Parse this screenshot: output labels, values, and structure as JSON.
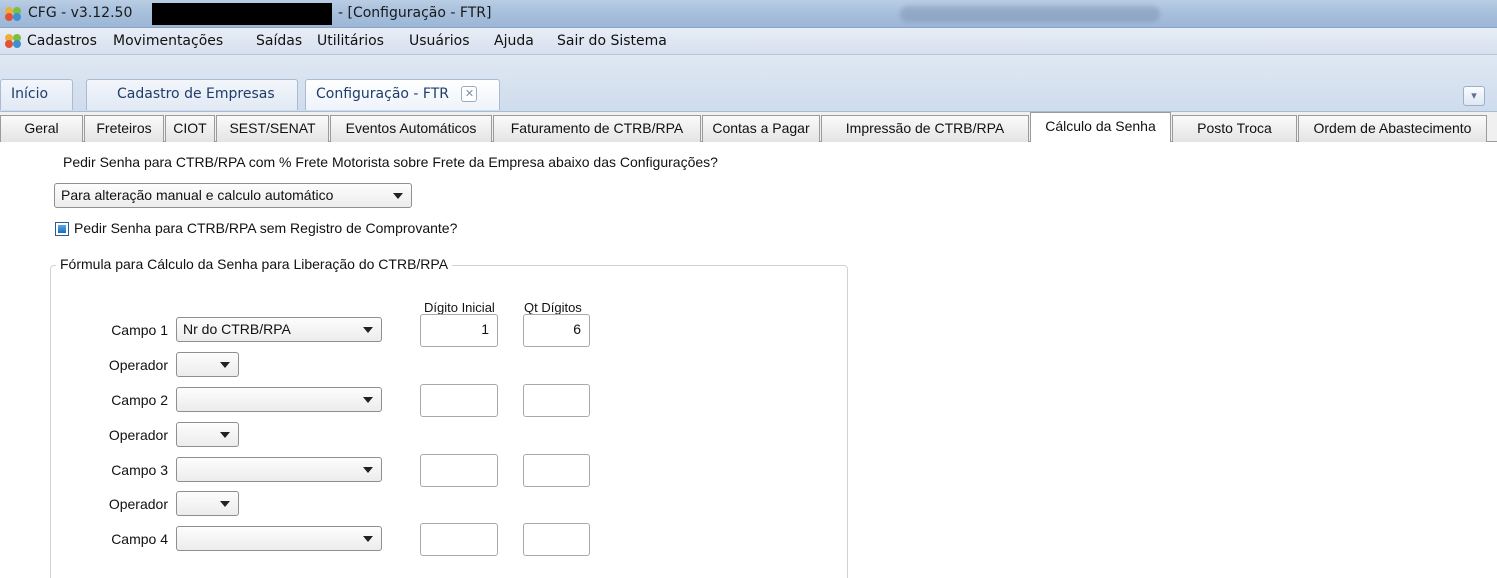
{
  "window": {
    "title_left": "CFG - v3.12.50",
    "title_right": "- [Configuração - FTR]"
  },
  "menu": {
    "items": [
      "Cadastros",
      "Movimentações",
      "Saídas",
      "Utilitários",
      "Usuários",
      "Ajuda",
      "Sair do Sistema"
    ]
  },
  "doc_tabs": {
    "items": [
      "Início",
      "Cadastro de Empresas",
      "Configuração - FTR"
    ],
    "active": "Configuração - FTR"
  },
  "sub_tabs": {
    "items": [
      "Geral",
      "Freteiros",
      "CIOT",
      "SEST/SENAT",
      "Eventos Automáticos",
      "Faturamento de CTRB/RPA",
      "Contas a Pagar",
      "Impressão de CTRB/RPA",
      "Cálculo da Senha",
      "Posto Troca",
      "Ordem de Abastecimento"
    ],
    "active": "Cálculo da Senha"
  },
  "form": {
    "question": "Pedir Senha para CTRB/RPA com % Frete Motorista sobre Frete da Empresa abaixo das Configurações?",
    "mode_select": "Para alteração manual e calculo automático",
    "checkbox_label": "Pedir Senha para CTRB/RPA sem Registro de Comprovante?",
    "checkbox_checked": true,
    "group_title": "Fórmula para Cálculo da Senha para Liberação do CTRB/RPA",
    "col_initial_digit": "Dígito Inicial",
    "col_qt_digits": "Qt Dígitos",
    "campo1_label": "Campo 1",
    "campo1_value": "Nr do CTRB/RPA",
    "campo1_initial": "1",
    "campo1_qt": "6",
    "operador1_label": "Operador",
    "operador1_value": "",
    "campo2_label": "Campo 2",
    "campo2_value": "",
    "campo2_initial": "",
    "campo2_qt": "",
    "operador2_label": "Operador",
    "operador2_value": "",
    "campo3_label": "Campo 3",
    "campo3_value": "",
    "campo3_initial": "",
    "campo3_qt": "",
    "operador3_label": "Operador",
    "operador3_value": "",
    "campo4_label": "Campo 4",
    "campo4_value": "",
    "campo4_initial": "",
    "campo4_qt": ""
  },
  "colors": {
    "titlebar": "#a6bfdc",
    "tab_text": "#1f3c6b",
    "checkbox_fill": "#1b6cc0"
  }
}
